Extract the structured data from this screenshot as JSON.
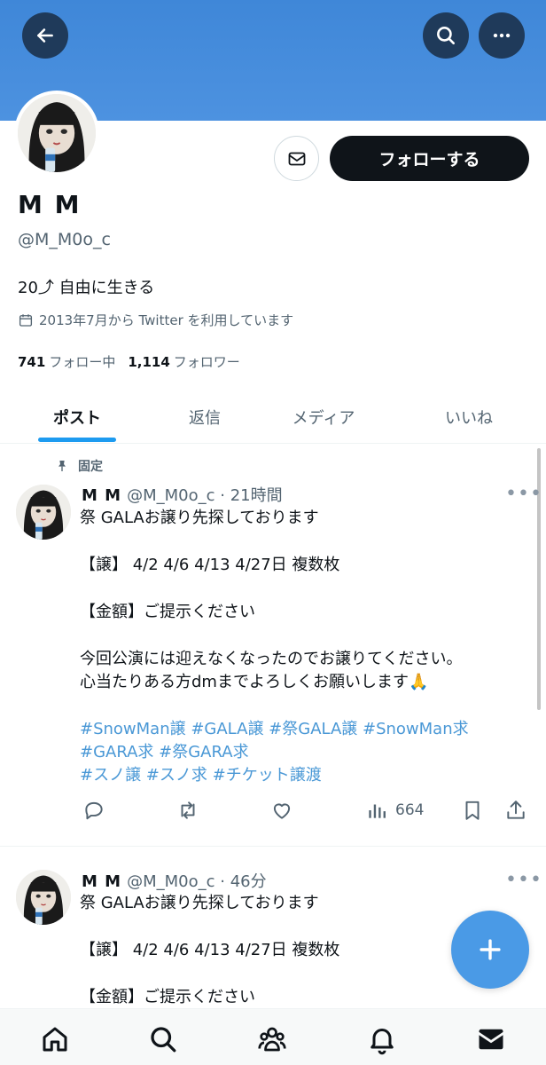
{
  "profile": {
    "name": "M M",
    "handle": "@M_M0o_c",
    "bio": "20⤴︎ 自由に生きる",
    "joined": "2013年7月から Twitter を利用しています",
    "following_count": "741",
    "following_label": "フォロー中",
    "followers_count": "1,114",
    "followers_label": "フォロワー",
    "follow_button": "フォローする"
  },
  "tabs": [
    "ポスト",
    "返信",
    "メディア",
    "いいね"
  ],
  "pinned_label": "固定",
  "tweets": [
    {
      "name": "M M",
      "handle": "@M_M0o_c",
      "time": "21時間",
      "lines": [
        "祭 GALAお譲り先探しております",
        "",
        "【譲】 4/2 4/6 4/13 4/27日 複数枚",
        "",
        "【金額】ご提示ください",
        "",
        "今回公演には迎えなくなったのでお譲りてください。",
        "心当たりある方dmまでよろしくお願いします🙏"
      ],
      "hashtags": [
        "#SnowMan譲 #GALA譲 #祭GALA譲 #SnowMan求",
        "#GARA求 #祭GARA求",
        " #スノ譲 #スノ求 #チケット譲渡"
      ],
      "views": "664"
    },
    {
      "name": "M M",
      "handle": "@M_M0o_c",
      "time": "46分",
      "lines": [
        "祭 GALAお譲り先探しております",
        "",
        "【譲】 4/2 4/6 4/13 4/27日 複数枚",
        "",
        "【金額】ご提示ください"
      ]
    }
  ],
  "colors": {
    "banner": "#4a90e0",
    "accent": "#1d9bf0",
    "hashtag": "#4a98d6",
    "fab": "#4a9ae6"
  },
  "icons": [
    "back-arrow-icon",
    "search-icon",
    "more-icon",
    "mail-icon",
    "calendar-icon",
    "pin-icon",
    "reply-icon",
    "retweet-icon",
    "like-icon",
    "views-icon",
    "bookmark-icon",
    "share-icon",
    "plus-icon",
    "home-icon",
    "people-icon",
    "bell-icon",
    "envelope-icon"
  ]
}
